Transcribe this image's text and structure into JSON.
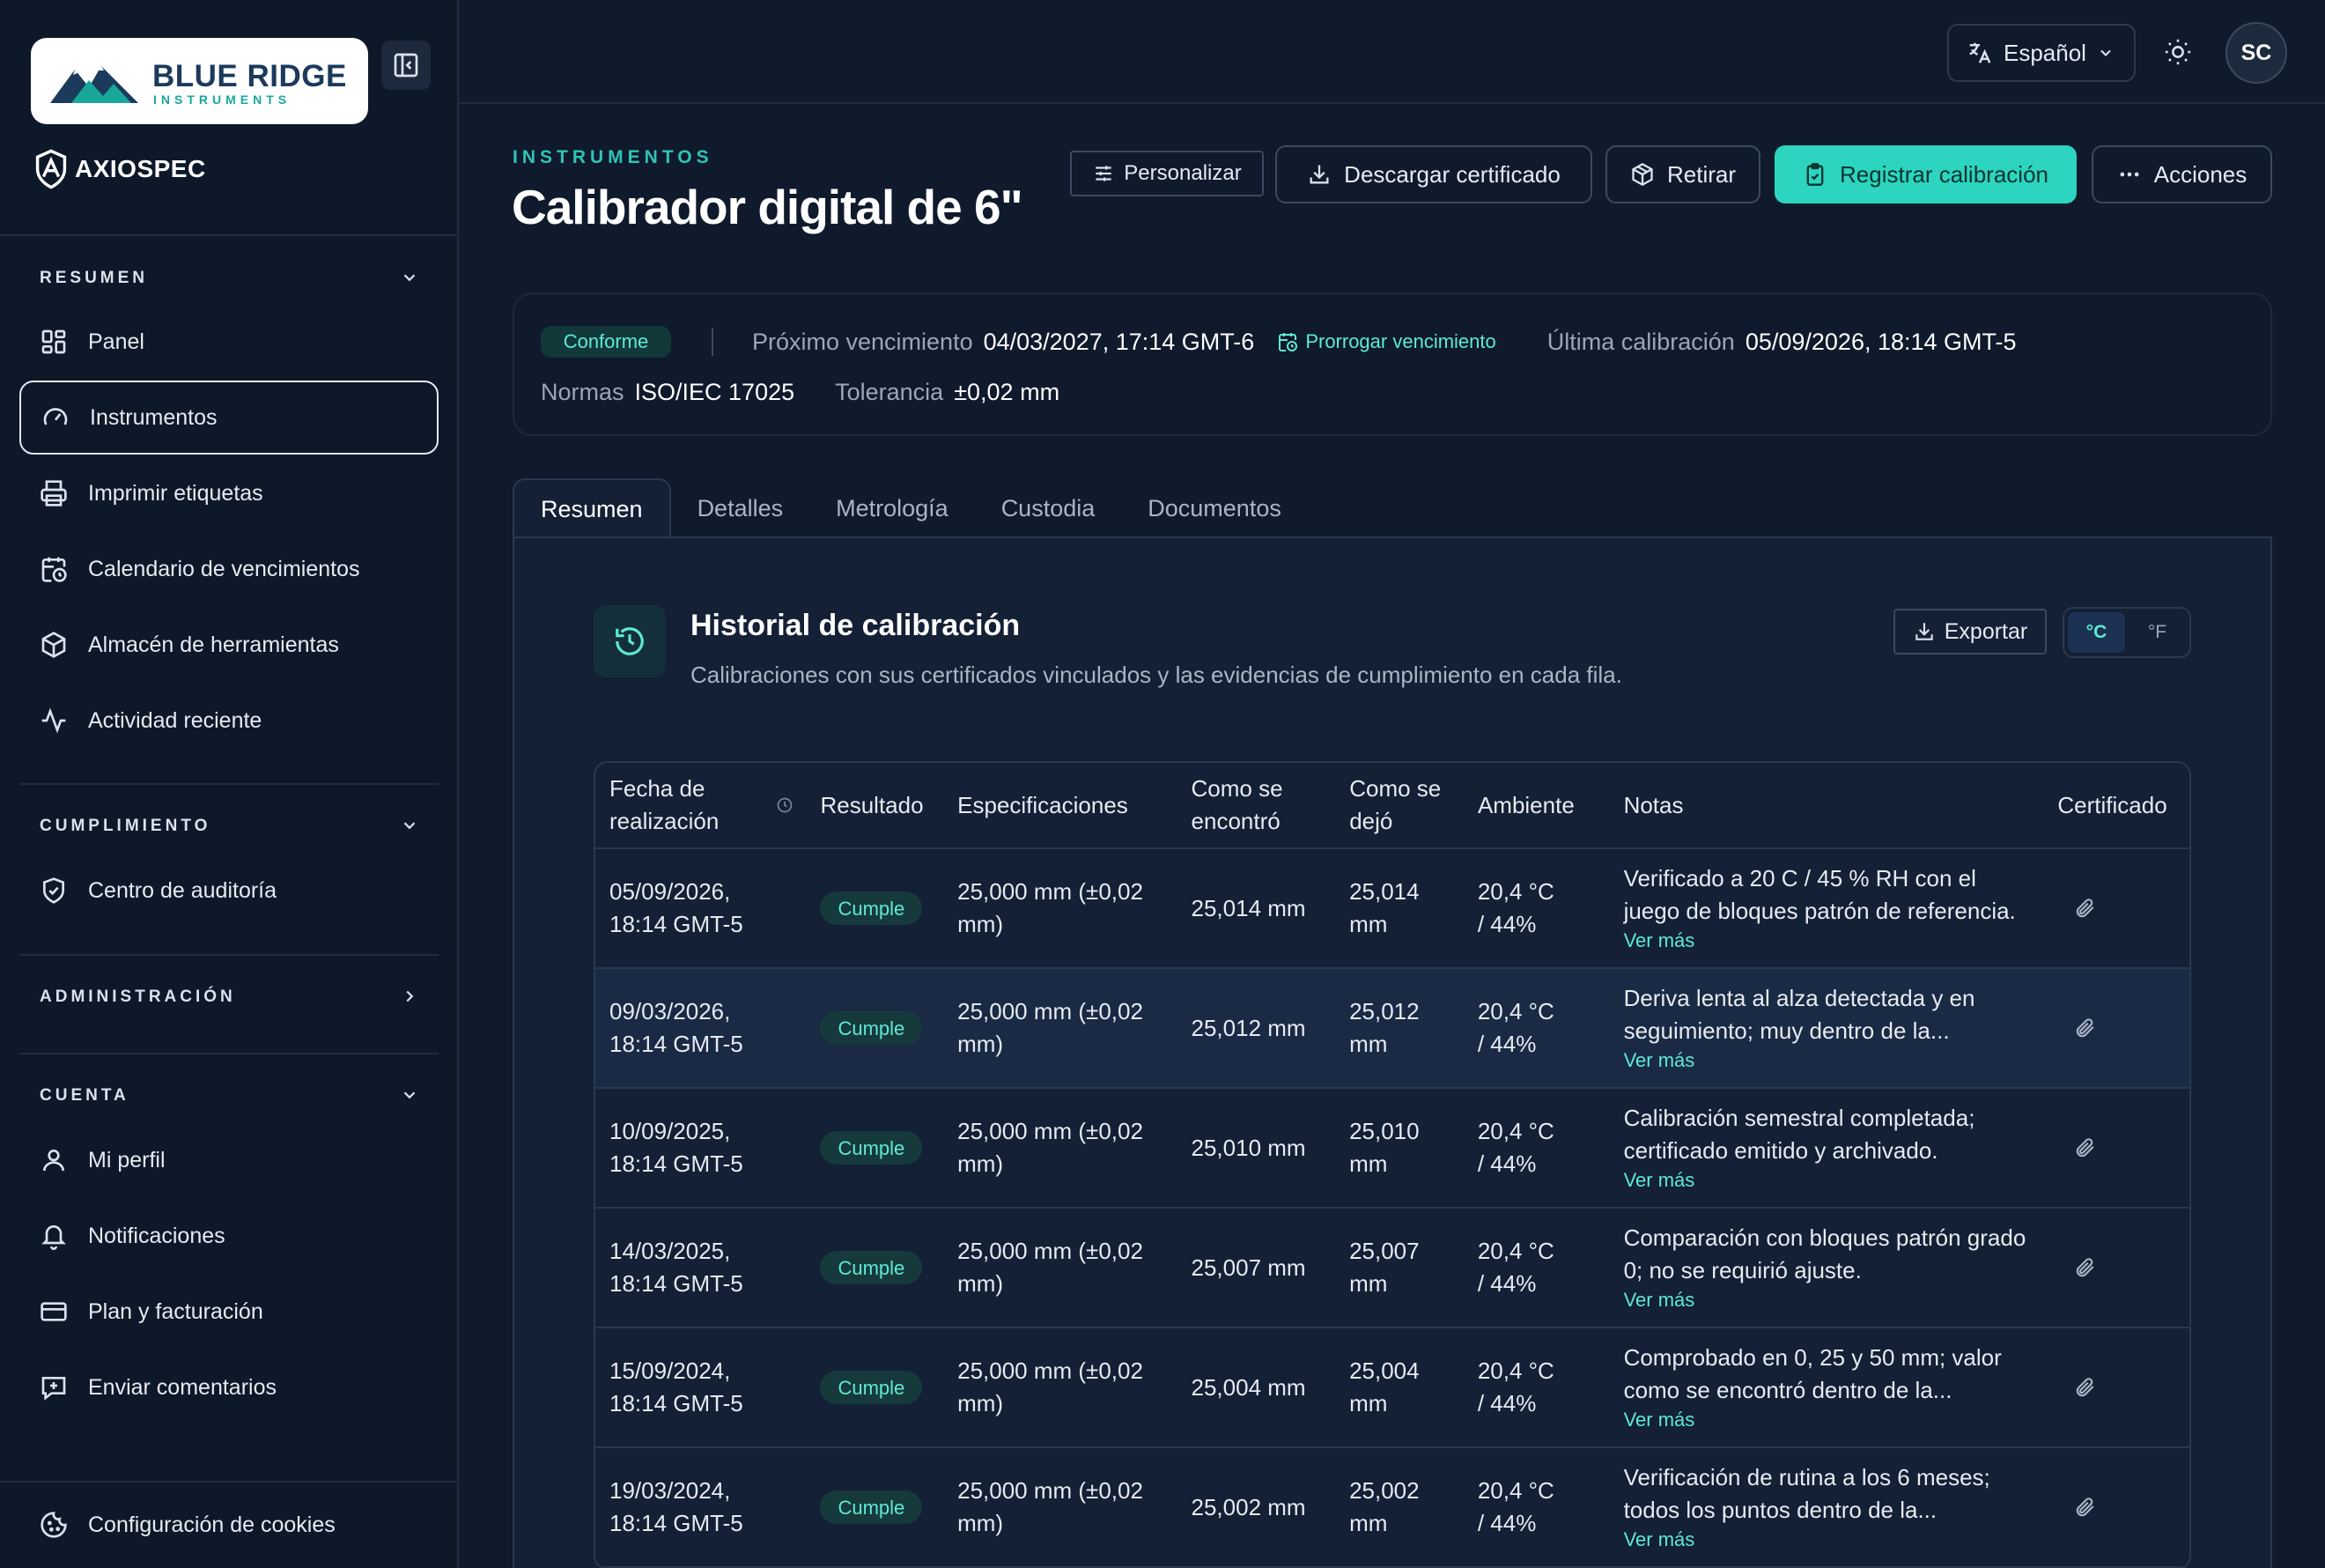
{
  "brand": {
    "name": "BLUE RIDGE",
    "sub": "INSTRUMENTS",
    "product": "AXIOSPEC"
  },
  "sidebar": {
    "sections": {
      "resumen": "RESUMEN",
      "cumplimiento": "CUMPLIMIENTO",
      "administracion": "ADMINISTRACIÓN",
      "cuenta": "CUENTA"
    },
    "items": {
      "panel": "Panel",
      "instrumentos": "Instrumentos",
      "imprimir": "Imprimir etiquetas",
      "calendario": "Calendario de vencimientos",
      "almacen": "Almacén de herramientas",
      "actividad": "Actividad reciente",
      "auditoria": "Centro de auditoría",
      "perfil": "Mi perfil",
      "notificaciones": "Notificaciones",
      "plan": "Plan y facturación",
      "comentarios": "Enviar comentarios",
      "cookies": "Configuración de cookies"
    }
  },
  "topbar": {
    "language": "Español",
    "avatar": "SC"
  },
  "header": {
    "eyebrow": "INSTRUMENTOS",
    "title": "Calibrador digital de 6\"",
    "buttons": {
      "personalizar": "Personalizar",
      "descargar": "Descargar certificado",
      "retirar": "Retirar",
      "registrar": "Registrar calibración",
      "acciones": "Acciones"
    }
  },
  "info": {
    "status": "Conforme",
    "next_due_label": "Próximo vencimiento",
    "next_due_value": "04/03/2027, 17:14 GMT-6",
    "extend": "Prorrogar vencimiento",
    "last_cal_label": "Última calibración",
    "last_cal_value": "05/09/2026, 18:14 GMT-5",
    "norms_label": "Normas",
    "norms_value": "ISO/IEC 17025",
    "tol_label": "Tolerancia",
    "tol_value": "±0,02 mm"
  },
  "tabs": [
    "Resumen",
    "Detalles",
    "Metrología",
    "Custodia",
    "Documentos"
  ],
  "history": {
    "title": "Historial de calibración",
    "subtitle": "Calibraciones con sus certificados vinculados y las evidencias de cumplimiento en cada fila.",
    "export": "Exportar",
    "units": [
      "°C",
      "°F"
    ],
    "columns": [
      "Fecha de realización",
      "Resultado",
      "Especificaciones",
      "Como se encontró",
      "Como se dejó",
      "Ambiente",
      "Notas",
      "Certificado"
    ],
    "more": "Ver más",
    "rows": [
      {
        "date": "05/09/2026, 18:14 GMT-5",
        "result": "Cumple",
        "spec": "25,000 mm (±0,02 mm)",
        "found": "25,014 mm",
        "left": "25,014 mm",
        "env": "20,4 °C / 44%",
        "notes": "Verificado a 20 C / 45 % RH con el juego de bloques patrón de referencia."
      },
      {
        "date": "09/03/2026, 18:14 GMT-5",
        "result": "Cumple",
        "spec": "25,000 mm (±0,02 mm)",
        "found": "25,012 mm",
        "left": "25,012 mm",
        "env": "20,4 °C / 44%",
        "notes": "Deriva lenta al alza detectada y en seguimiento; muy dentro de la..."
      },
      {
        "date": "10/09/2025, 18:14 GMT-5",
        "result": "Cumple",
        "spec": "25,000 mm (±0,02 mm)",
        "found": "25,010 mm",
        "left": "25,010 mm",
        "env": "20,4 °C / 44%",
        "notes": "Calibración semestral completada; certificado emitido y archivado."
      },
      {
        "date": "14/03/2025, 18:14 GMT-5",
        "result": "Cumple",
        "spec": "25,000 mm (±0,02 mm)",
        "found": "25,007 mm",
        "left": "25,007 mm",
        "env": "20,4 °C / 44%",
        "notes": "Comparación con bloques patrón grado 0; no se requirió ajuste."
      },
      {
        "date": "15/09/2024, 18:14 GMT-5",
        "result": "Cumple",
        "spec": "25,000 mm (±0,02 mm)",
        "found": "25,004 mm",
        "left": "25,004 mm",
        "env": "20,4 °C / 44%",
        "notes": "Comprobado en 0, 25 y 50 mm; valor como se encontró dentro de la..."
      },
      {
        "date": "19/03/2024, 18:14 GMT-5",
        "result": "Cumple",
        "spec": "25,000 mm (±0,02 mm)",
        "found": "25,002 mm",
        "left": "25,002 mm",
        "env": "20,4 °C / 44%",
        "notes": "Verificación de rutina a los 6 meses; todos los puntos dentro de la..."
      }
    ]
  }
}
